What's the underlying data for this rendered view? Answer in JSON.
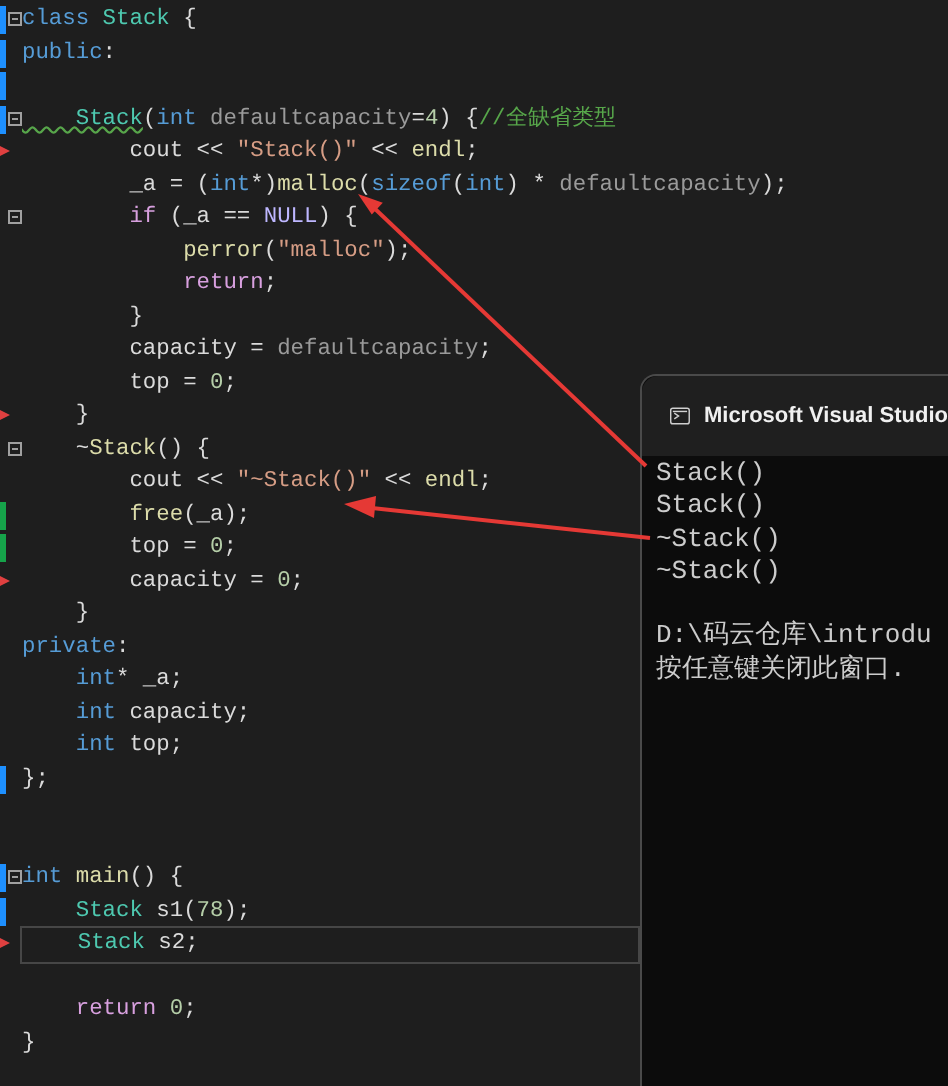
{
  "editor": {
    "lines": [
      {
        "fold": true,
        "color": "#1e90ff",
        "tokens": [
          {
            "text": "class ",
            "kind": "kw"
          },
          {
            "text": "Stack",
            "kind": "type"
          },
          {
            "text": " {",
            "kind": "plain"
          }
        ]
      },
      {
        "color": "#1e90ff",
        "tokens": [
          {
            "text": "public",
            "kind": "kw"
          },
          {
            "text": ":",
            "kind": "plain"
          }
        ]
      },
      {
        "color": "#1e90ff"
      },
      {
        "fold": true,
        "color": "#1e90ff",
        "tokens": [
          {
            "text": "    Stack",
            "kind": "type",
            "squiggle": true
          },
          {
            "text": "(",
            "kind": "plain"
          },
          {
            "text": "int ",
            "kind": "kw"
          },
          {
            "text": "defaultcapacity",
            "kind": "param"
          },
          {
            "text": "=",
            "kind": "plain"
          },
          {
            "text": "4",
            "kind": "num"
          },
          {
            "text": ") {",
            "kind": "plain"
          },
          {
            "text": "//全缺省类型",
            "kind": "cmt"
          }
        ]
      },
      {
        "marker": true,
        "tokens": [
          {
            "text": "        cout << ",
            "kind": "plain"
          },
          {
            "text": "\"Stack()\"",
            "kind": "str"
          },
          {
            "text": " << ",
            "kind": "plain"
          },
          {
            "text": "endl",
            "kind": "fn"
          },
          {
            "text": ";",
            "kind": "plain"
          }
        ]
      },
      {
        "tokens": [
          {
            "text": "        _a = (",
            "kind": "plain"
          },
          {
            "text": "int",
            "kind": "kw"
          },
          {
            "text": "*)",
            "kind": "plain"
          },
          {
            "text": "malloc",
            "kind": "fn"
          },
          {
            "text": "(",
            "kind": "plain"
          },
          {
            "text": "sizeof",
            "kind": "kw"
          },
          {
            "text": "(",
            "kind": "plain"
          },
          {
            "text": "int",
            "kind": "kw"
          },
          {
            "text": ") * ",
            "kind": "plain"
          },
          {
            "text": "defaultcapacity",
            "kind": "param"
          },
          {
            "text": ");",
            "kind": "plain"
          }
        ]
      },
      {
        "fold": true,
        "tokens": [
          {
            "text": "        if",
            "kind": "ctrl"
          },
          {
            "text": " (_a == ",
            "kind": "plain"
          },
          {
            "text": "NULL",
            "kind": "macro"
          },
          {
            "text": ") {",
            "kind": "plain"
          }
        ]
      },
      {
        "tokens": [
          {
            "text": "            perror",
            "kind": "fn"
          },
          {
            "text": "(",
            "kind": "plain"
          },
          {
            "text": "\"malloc\"",
            "kind": "str"
          },
          {
            "text": ");",
            "kind": "plain"
          }
        ]
      },
      {
        "tokens": [
          {
            "text": "            return",
            "kind": "ctrl"
          },
          {
            "text": ";",
            "kind": "plain"
          }
        ]
      },
      {
        "tokens": [
          {
            "text": "        }",
            "kind": "plain"
          }
        ]
      },
      {
        "tokens": [
          {
            "text": "        capacity = ",
            "kind": "plain"
          },
          {
            "text": "defaultcapacity",
            "kind": "param"
          },
          {
            "text": ";",
            "kind": "plain"
          }
        ]
      },
      {
        "tokens": [
          {
            "text": "        top = ",
            "kind": "plain"
          },
          {
            "text": "0",
            "kind": "num"
          },
          {
            "text": ";",
            "kind": "plain"
          }
        ]
      },
      {
        "marker": true,
        "tokens": [
          {
            "text": "    }",
            "kind": "plain"
          }
        ]
      },
      {
        "fold": true,
        "tokens": [
          {
            "text": "    ~",
            "kind": "plain"
          },
          {
            "text": "Stack",
            "kind": "fn"
          },
          {
            "text": "() {",
            "kind": "plain"
          }
        ]
      },
      {
        "tokens": [
          {
            "text": "        cout << ",
            "kind": "plain"
          },
          {
            "text": "\"~Stack()\"",
            "kind": "str"
          },
          {
            "text": " << ",
            "kind": "plain"
          },
          {
            "text": "endl",
            "kind": "fn"
          },
          {
            "text": ";",
            "kind": "plain"
          }
        ]
      },
      {
        "color": "#16a34a",
        "tokens": [
          {
            "text": "        free",
            "kind": "fn"
          },
          {
            "text": "(_a);",
            "kind": "plain"
          }
        ]
      },
      {
        "color": "#16a34a",
        "tokens": [
          {
            "text": "        top = ",
            "kind": "plain"
          },
          {
            "text": "0",
            "kind": "num"
          },
          {
            "text": ";",
            "kind": "plain"
          }
        ]
      },
      {
        "marker": true,
        "tokens": [
          {
            "text": "        capacity = ",
            "kind": "plain"
          },
          {
            "text": "0",
            "kind": "num"
          },
          {
            "text": ";",
            "kind": "plain"
          }
        ]
      },
      {
        "tokens": [
          {
            "text": "    }",
            "kind": "plain"
          }
        ]
      },
      {
        "tokens": [
          {
            "text": "private",
            "kind": "kw"
          },
          {
            "text": ":",
            "kind": "plain"
          }
        ]
      },
      {
        "tokens": [
          {
            "text": "    int",
            "kind": "kw"
          },
          {
            "text": "* _a;",
            "kind": "plain"
          }
        ]
      },
      {
        "tokens": [
          {
            "text": "    int",
            "kind": "kw"
          },
          {
            "text": " capacity;",
            "kind": "plain"
          }
        ]
      },
      {
        "tokens": [
          {
            "text": "    int",
            "kind": "kw"
          },
          {
            "text": " top;",
            "kind": "plain"
          }
        ]
      },
      {
        "color": "#1e90ff",
        "tokens": [
          {
            "text": "};",
            "kind": "plain"
          }
        ]
      },
      {
        "blank": true
      },
      {
        "blank": true
      },
      {
        "fold": true,
        "color": "#1e90ff",
        "tokens": [
          {
            "text": "int ",
            "kind": "kw"
          },
          {
            "text": "main",
            "kind": "fn"
          },
          {
            "text": "() {",
            "kind": "plain"
          }
        ]
      },
      {
        "color": "#1e90ff",
        "tokens": [
          {
            "text": "    Stack",
            "kind": "type"
          },
          {
            "text": " s1(",
            "kind": "plain"
          },
          {
            "text": "78",
            "kind": "num"
          },
          {
            "text": ");",
            "kind": "plain"
          }
        ]
      },
      {
        "current": true,
        "marker": true,
        "tokens": [
          {
            "text": "    Stack",
            "kind": "type"
          },
          {
            "text": " s2;",
            "kind": "plain"
          }
        ]
      },
      {
        "blank": true
      },
      {
        "tokens": [
          {
            "text": "    return",
            "kind": "ctrl"
          },
          {
            "text": " 0",
            "kind": "num"
          },
          {
            "text": ";",
            "kind": "plain"
          }
        ]
      },
      {
        "tokens": [
          {
            "text": "}",
            "kind": "plain"
          }
        ]
      }
    ]
  },
  "console": {
    "title": "Microsoft Visual Studio",
    "lines": [
      {
        "text": "Stack()"
      },
      {
        "text": "Stack()"
      },
      {
        "text": "~Stack()"
      },
      {
        "text": "~Stack()"
      },
      {
        "blank": true
      },
      {
        "text": "D:\\码云仓库\\introdu"
      },
      {
        "text": "按任意键关闭此窗口."
      }
    ]
  }
}
